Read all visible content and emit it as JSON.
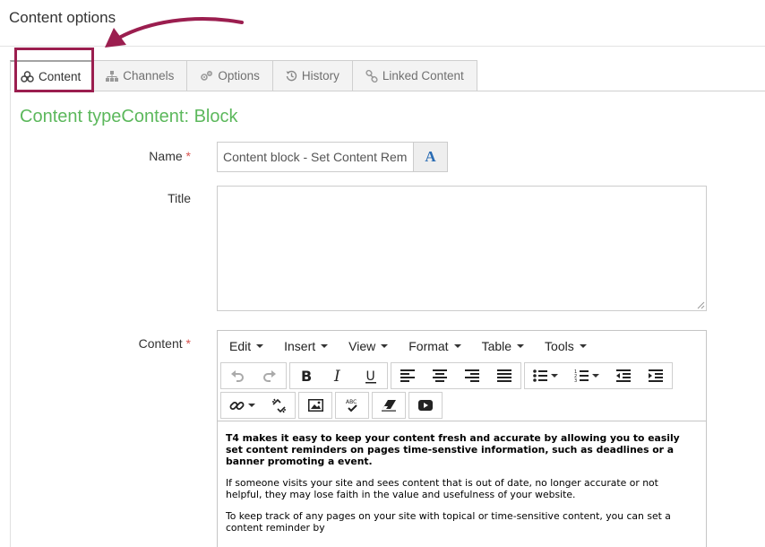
{
  "page": {
    "title": "Content options"
  },
  "tabs": [
    {
      "label": "Content",
      "icon": "cubes-icon",
      "active": true
    },
    {
      "label": "Channels",
      "icon": "sitemap-icon"
    },
    {
      "label": "Options",
      "icon": "cogs-icon"
    },
    {
      "label": "History",
      "icon": "history-icon"
    },
    {
      "label": "Linked Content",
      "icon": "link-icon"
    }
  ],
  "content_type": "Content typeContent: Block",
  "form": {
    "name_label": "Name",
    "required_marker": "*",
    "name_value": "Content block - Set Content Rem",
    "name_addon": "A",
    "title_label": "Title",
    "title_value": "",
    "content_label": "Content"
  },
  "editor": {
    "menus": [
      "Edit",
      "Insert",
      "View",
      "Format",
      "Table",
      "Tools"
    ],
    "toolbar_icons": [
      "undo-icon",
      "redo-icon",
      "bold-icon",
      "italic-icon",
      "underline-icon",
      "align-left-icon",
      "align-center-icon",
      "align-right-icon",
      "align-justify-icon",
      "bullet-list-icon",
      "numbered-list-icon",
      "outdent-icon",
      "indent-icon",
      "link-icon",
      "unlink-icon",
      "image-icon",
      "spellcheck-icon",
      "eraser-icon",
      "video-icon"
    ],
    "body": {
      "p1": "T4 makes it easy to keep your content fresh and accurate by allowing you to easily set content reminders on pages time-senstive information, such as deadlines or a banner promoting a event.",
      "p2": "If someone visits your site and sees content that is out of date, no longer accurate or not helpful, they may lose faith in the value and usefulness of your website.",
      "p3": "To keep track of any pages on your site with topical or time-sensitive content, you can set a content reminder by"
    }
  },
  "colors": {
    "accent_green": "#5cb85c",
    "highlight": "#9b1e4f",
    "required": "#d9534f"
  }
}
